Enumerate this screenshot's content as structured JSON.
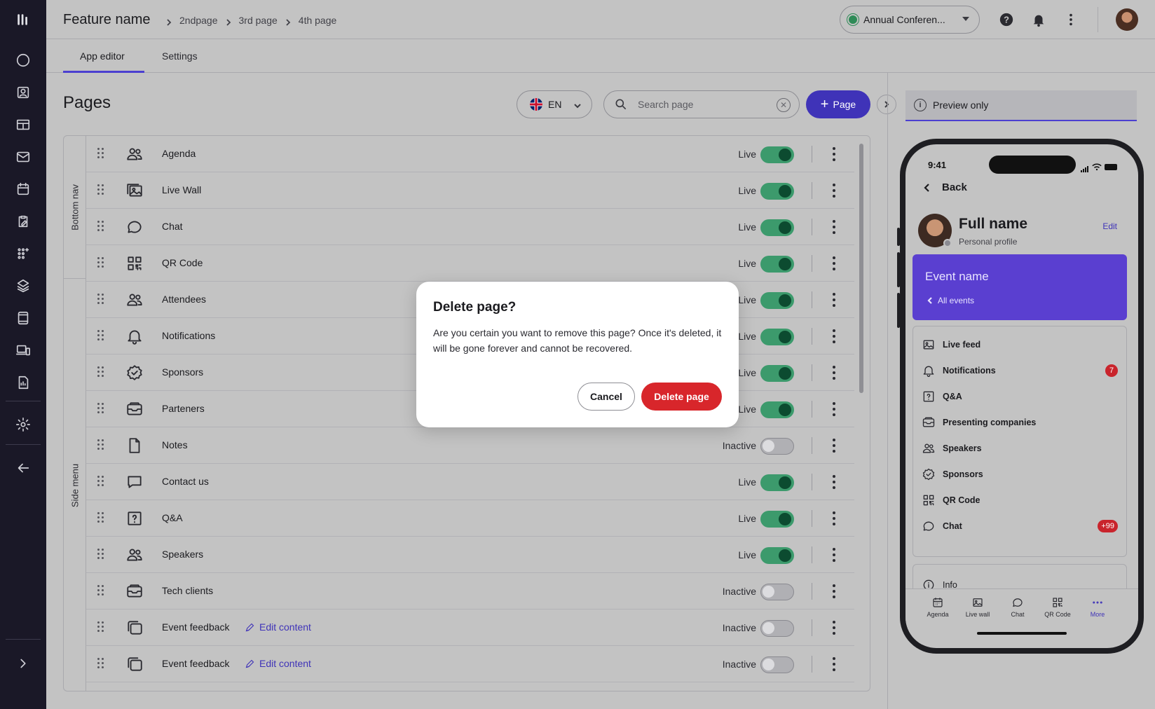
{
  "header": {
    "feature_title": "Feature name",
    "breadcrumbs": [
      "2ndpage",
      "3rd page",
      "4th page"
    ],
    "event_selector": "Annual Conferen...",
    "icons": [
      "help-icon",
      "bell-icon",
      "more-vertical-icon",
      "avatar"
    ]
  },
  "tabs": [
    {
      "label": "App editor",
      "active": true
    },
    {
      "label": "Settings",
      "active": false
    }
  ],
  "pages": {
    "title": "Pages",
    "language": "EN",
    "search_placeholder": "Search page",
    "add_button": "Page",
    "groups": [
      "Bottom nav",
      "Side menu"
    ],
    "rows": [
      {
        "icon": "people-icon",
        "label": "Agenda",
        "status": "Live",
        "on": true
      },
      {
        "icon": "image-stack-icon",
        "label": "Live Wall",
        "status": "Live",
        "on": true
      },
      {
        "icon": "chat-icon",
        "label": "Chat",
        "status": "Live",
        "on": true
      },
      {
        "icon": "qr-code-icon",
        "label": "QR Code",
        "status": "Live",
        "on": true
      },
      {
        "icon": "people-icon",
        "label": "Attendees",
        "status": "Live",
        "on": true
      },
      {
        "icon": "bell-icon",
        "label": "Notifications",
        "status": "Live",
        "on": true
      },
      {
        "icon": "badge-check-icon",
        "label": "Sponsors",
        "status": "Live",
        "on": true
      },
      {
        "icon": "inbox-icon",
        "label": "Parteners",
        "status": "Live",
        "on": true
      },
      {
        "icon": "document-icon",
        "label": "Notes",
        "status": "Inactive",
        "on": false
      },
      {
        "icon": "message-square-icon",
        "label": "Contact us",
        "status": "Live",
        "on": true
      },
      {
        "icon": "question-square-icon",
        "label": "Q&A",
        "status": "Live",
        "on": true
      },
      {
        "icon": "people-icon",
        "label": "Speakers",
        "status": "Live",
        "on": true
      },
      {
        "icon": "inbox-icon",
        "label": "Tech clients",
        "status": "Inactive",
        "on": false
      },
      {
        "icon": "window-stack-icon",
        "label": "Event feedback",
        "edit": "Edit content",
        "status": "Inactive",
        "on": false
      },
      {
        "icon": "window-stack-icon",
        "label": "Event feedback",
        "edit": "Edit content",
        "status": "Inactive",
        "on": false
      }
    ]
  },
  "preview": {
    "label": "Preview only",
    "phone": {
      "time": "9:41",
      "back": "Back",
      "name": "Full name",
      "subtitle": "Personal profile",
      "edit": "Edit",
      "event_name": "Event name",
      "all_events": "All events",
      "menu": [
        {
          "icon": "image-icon",
          "label": "Live feed"
        },
        {
          "icon": "bell-icon",
          "label": "Notifications",
          "badge": "7"
        },
        {
          "icon": "question-square-icon",
          "label": "Q&A"
        },
        {
          "icon": "inbox-icon",
          "label": "Presenting companies"
        },
        {
          "icon": "people-icon",
          "label": "Speakers"
        },
        {
          "icon": "badge-check-icon",
          "label": "Sponsors"
        },
        {
          "icon": "qr-code-icon",
          "label": "QR Code"
        },
        {
          "icon": "chat-icon",
          "label": "Chat",
          "badge": "+99"
        }
      ],
      "info": "Info",
      "tabbar": [
        {
          "icon": "calendar-icon",
          "label": "Agenda"
        },
        {
          "icon": "image-icon",
          "label": "Live wall"
        },
        {
          "icon": "chat-icon",
          "label": "Chat"
        },
        {
          "icon": "qr-code-icon",
          "label": "QR Code"
        },
        {
          "icon": "more-horizontal-icon",
          "label": "More",
          "active": true
        }
      ]
    }
  },
  "modal": {
    "title": "Delete page?",
    "body": "Are you certain you want to remove this page? Once it's deleted, it will be gone forever and cannot be recovered.",
    "cancel": "Cancel",
    "confirm": "Delete page"
  },
  "colors": {
    "accent": "#3f33b8",
    "toggle_on": "#3c9a6c",
    "danger": "#d8262b",
    "rail": "#1a1827"
  }
}
